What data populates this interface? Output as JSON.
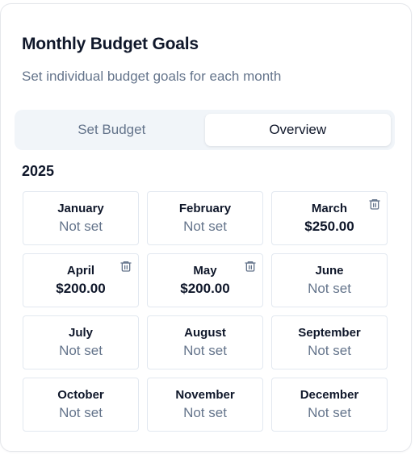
{
  "card": {
    "title": "Monthly Budget Goals",
    "subtitle": "Set individual budget goals for each month"
  },
  "tabs": [
    {
      "label": "Set Budget",
      "active": false
    },
    {
      "label": "Overview",
      "active": true
    }
  ],
  "year": "2025",
  "months": [
    {
      "name": "January",
      "value": "Not set",
      "set": false
    },
    {
      "name": "February",
      "value": "Not set",
      "set": false
    },
    {
      "name": "March",
      "value": "$250.00",
      "set": true
    },
    {
      "name": "April",
      "value": "$200.00",
      "set": true
    },
    {
      "name": "May",
      "value": "$200.00",
      "set": true
    },
    {
      "name": "June",
      "value": "Not set",
      "set": false
    },
    {
      "name": "July",
      "value": "Not set",
      "set": false
    },
    {
      "name": "August",
      "value": "Not set",
      "set": false
    },
    {
      "name": "September",
      "value": "Not set",
      "set": false
    },
    {
      "name": "October",
      "value": "Not set",
      "set": false
    },
    {
      "name": "November",
      "value": "Not set",
      "set": false
    },
    {
      "name": "December",
      "value": "Not set",
      "set": false
    }
  ],
  "icons": {
    "delete": "trash-icon"
  },
  "colors": {
    "text_primary": "#0f172a",
    "text_muted": "#64748b",
    "tab_track": "#f1f5f9",
    "border": "#e2e8f0"
  }
}
